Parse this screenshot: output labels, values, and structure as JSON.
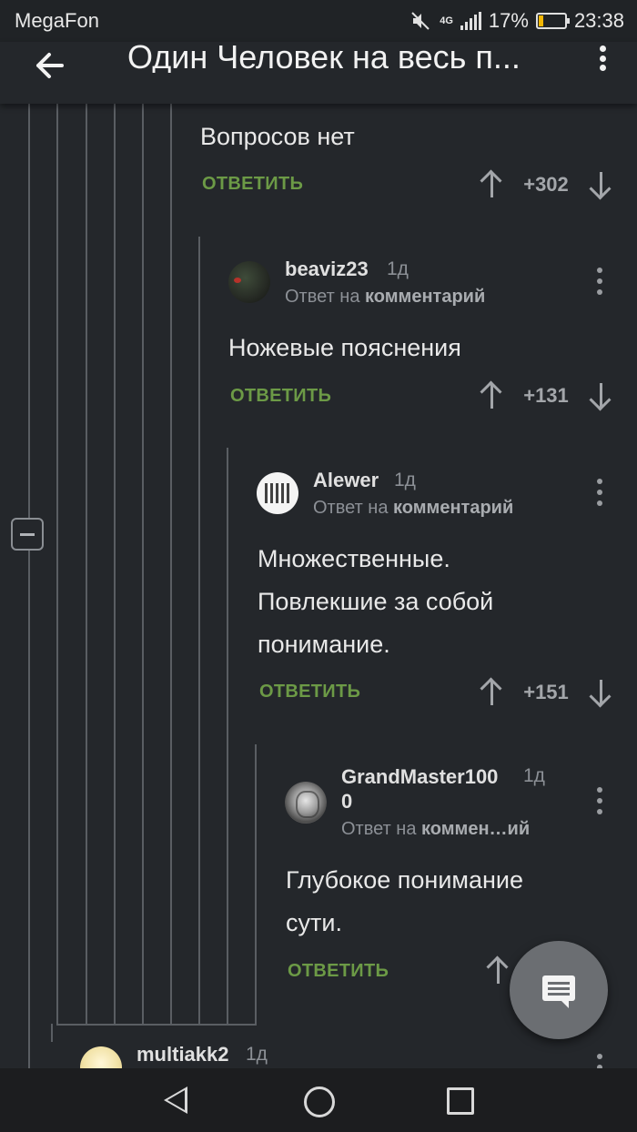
{
  "status_bar": {
    "carrier": "MegaFon",
    "network": "4G",
    "battery_percent": "17%",
    "battery_level": 0.17,
    "time": "23:38"
  },
  "header": {
    "title": "Один Человек на весь п..."
  },
  "comments": [
    {
      "text": "Вопросов нет",
      "reply_label": "ОТВЕТИТЬ",
      "score": "+302"
    },
    {
      "username": "beaviz23",
      "time": "1д",
      "reply_prefix": "Ответ на",
      "reply_target": "комментарий",
      "text": "Ножевые пояснения",
      "reply_label": "ОТВЕТИТЬ",
      "score": "+131"
    },
    {
      "username": "Alewer",
      "time": "1д",
      "reply_prefix": "Ответ на",
      "reply_target": "комментарий",
      "text_lines": [
        "Множественные.",
        "Повлекшие за собой",
        "понимание."
      ],
      "reply_label": "ОТВЕТИТЬ",
      "score": "+151"
    },
    {
      "username_lines": [
        "GrandMaster100",
        "0"
      ],
      "time": "1д",
      "reply_prefix": "Ответ на",
      "reply_target": "коммен…ий",
      "text_lines": [
        "Глубокое понимание",
        "сути."
      ],
      "reply_label": "ОТВЕТИТЬ"
    },
    {
      "username": "multiakk2",
      "time": "1д"
    }
  ],
  "icons": {
    "back": "arrow-left-icon",
    "more": "more-vert-icon",
    "fab": "comment-icon",
    "collapse": "collapse-minus-icon"
  },
  "colors": {
    "background": "#24272b",
    "accent_green": "#6c9a46",
    "battery": "#f2b705"
  }
}
